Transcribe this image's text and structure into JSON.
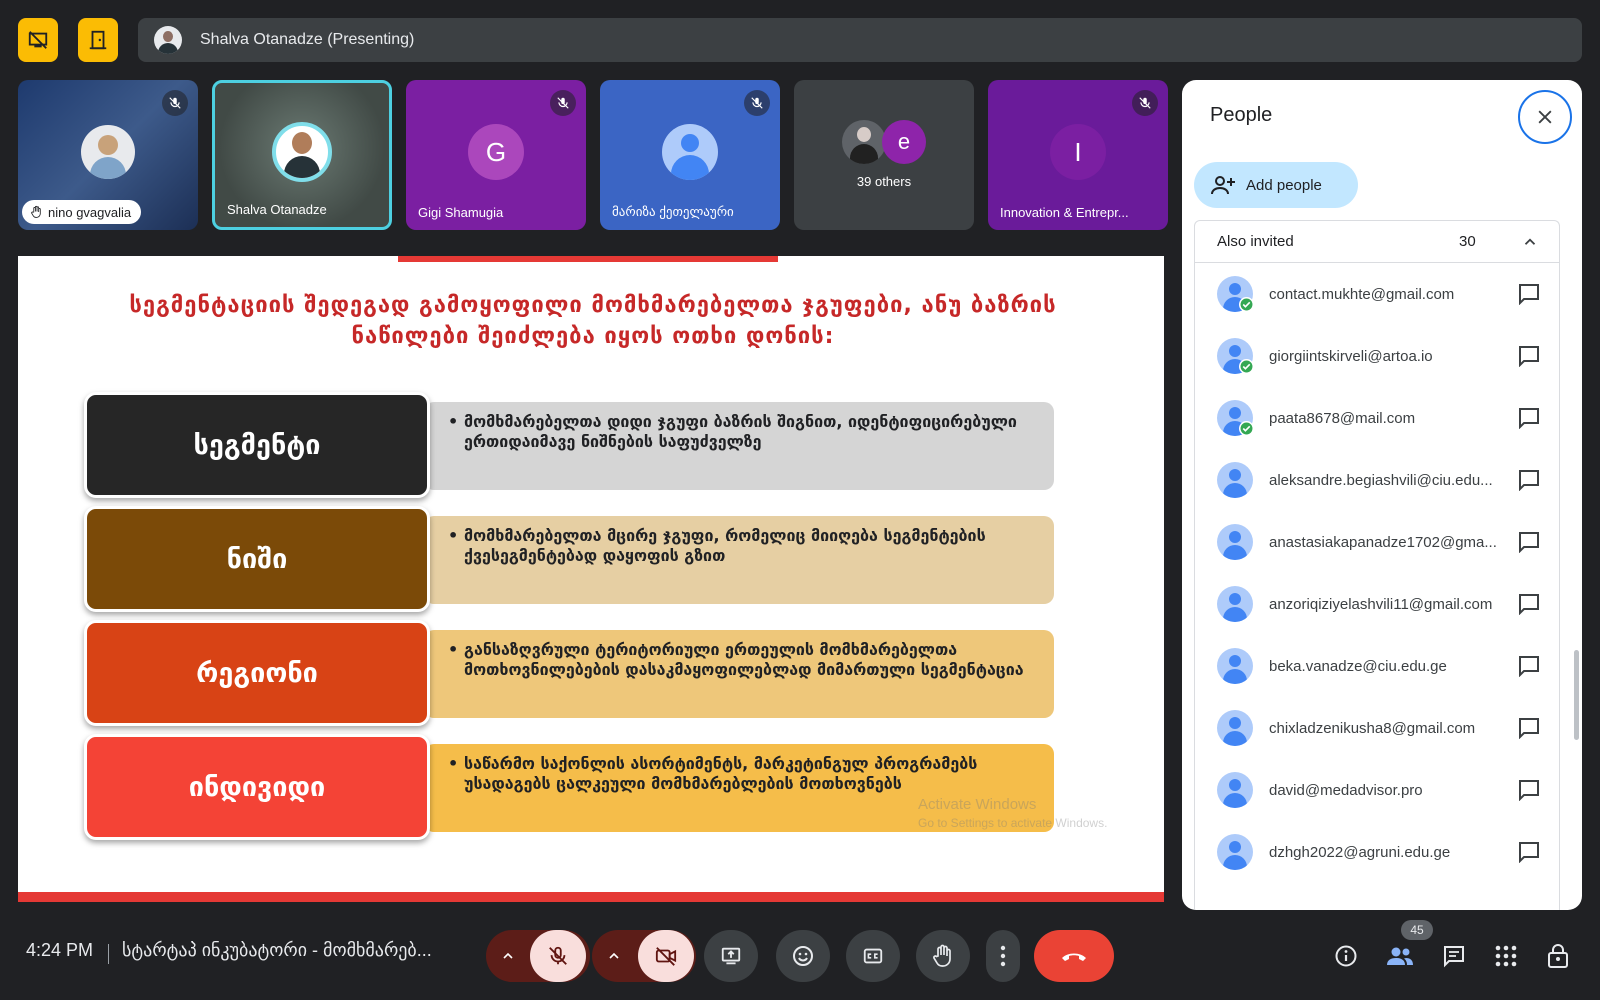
{
  "top_bar": {
    "presenter_label": "Shalva Otanadze (Presenting)"
  },
  "tiles": [
    {
      "name": "nino gvagvalia",
      "muted": true
    },
    {
      "name": "Shalva Otanadze",
      "muted": false
    },
    {
      "name": "Gigi Shamugia",
      "initial": "G",
      "muted": true
    },
    {
      "name": "მარიზა ქეთელაური",
      "muted": true
    },
    {
      "name": "39 others",
      "initial": "e"
    },
    {
      "name": "Innovation & Entrepr...",
      "initial": "I",
      "muted": true
    }
  ],
  "slide": {
    "title": "სეგმენტაციის შედეგად გამოყოფილი მომხმარებელთა ჯგუფები, ანუ ბაზრის ნაწილები შეიძლება იყოს ოთხი დონის:",
    "rows": [
      {
        "label": "სეგმენტი",
        "desc": "მომხმარებელთა დიდი ჯგუფი ბაზრის შიგნით, იდენტიფიცირებული ერთიდაიმავე ნიშნების საფუძველზე"
      },
      {
        "label": "ნიში",
        "desc": "მომხმარებელთა მცირე ჯგუფი, რომელიც მიიღება სეგმენტების ქვესეგმენტებად დაყოფის გზით"
      },
      {
        "label": "რეგიონი",
        "desc": "განსაზღვრული ტერიტორიული ერთეულის მომხმარებელთა მოთხოვნილებების დასაკმაყოფილებლად მიმართული სეგმენტაცია"
      },
      {
        "label": "ინდივიდი",
        "desc": "საწარმო საქონლის ასორტიმენტს, მარკეტინგულ პროგრამებს უსადაგებს ცალკეული მომხმარებლების მოთხოვნებს"
      }
    ],
    "watermark_line1": "Activate Windows",
    "watermark_line2": "Go to Settings to activate Windows."
  },
  "people_panel": {
    "title": "People",
    "add_people_label": "Add people",
    "group_label": "Also invited",
    "group_count": "30",
    "people": [
      {
        "email": "contact.mukhte@gmail.com",
        "accepted": true
      },
      {
        "email": "giorgiintskirveli@artoa.io",
        "accepted": true
      },
      {
        "email": "paata8678@mail.com",
        "accepted": true
      },
      {
        "email": "aleksandre.begiashvili@ciu.edu...",
        "accepted": false
      },
      {
        "email": "anastasiakapanadze1702@gma...",
        "accepted": false
      },
      {
        "email": "anzoriqiziyelashvili11@gmail.com",
        "accepted": false
      },
      {
        "email": "beka.vanadze@ciu.edu.ge",
        "accepted": false
      },
      {
        "email": "chixladzenikusha8@gmail.com",
        "accepted": false
      },
      {
        "email": "david@medadvisor.pro",
        "accepted": false
      },
      {
        "email": "dzhgh2022@agruni.edu.ge",
        "accepted": false
      }
    ]
  },
  "bottom_bar": {
    "time": "4:24 PM",
    "meeting_title": "სტარტაპ ინკუბატორი - მომხმარებ...",
    "participants_count": "45"
  },
  "colors": {
    "accent_yellow": "#fbbc04",
    "end_call_red": "#ea4335",
    "slide_red": "#c62828",
    "row_segment": "#262626",
    "row_niche": "#7b4a08",
    "row_region": "#d84315",
    "row_individual": "#f44336"
  }
}
